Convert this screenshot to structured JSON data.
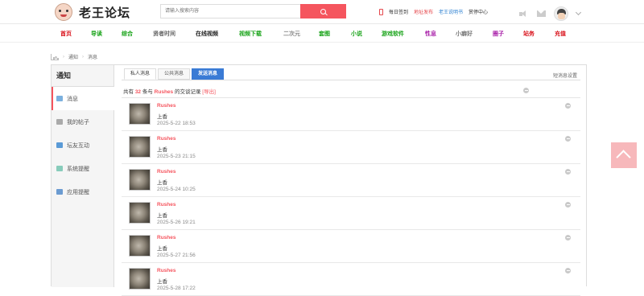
{
  "site": {
    "title": "老王论坛"
  },
  "search": {
    "placeholder": "请输入搜索内容"
  },
  "toplinks": {
    "signin": "每日签到",
    "address": "地址发布",
    "guide": "老王说明书",
    "bounty": "赏停中心"
  },
  "nav": [
    {
      "label": "首页",
      "color": "#d9121b"
    },
    {
      "label": "导读",
      "color": "#18a318"
    },
    {
      "label": "综合",
      "color": "#18a318"
    },
    {
      "label": "贤者时间",
      "color": "#666666"
    },
    {
      "label": "在线视频",
      "color": "#222222"
    },
    {
      "label": "视频下载",
      "color": "#18a318"
    },
    {
      "label": "二次元",
      "color": "#888888"
    },
    {
      "label": "套图",
      "color": "#18a318"
    },
    {
      "label": "小说",
      "color": "#18a318"
    },
    {
      "label": "游戏软件",
      "color": "#18a318"
    },
    {
      "label": "性息",
      "color": "#a81ea8"
    },
    {
      "label": "小癖好",
      "color": "#777777"
    },
    {
      "label": "圈子",
      "color": "#a81ea8"
    },
    {
      "label": "站务",
      "color": "#d9121b"
    },
    {
      "label": "充值",
      "color": "#d9121b"
    }
  ],
  "breadcrumb": {
    "level1": "通知",
    "level2": "消息"
  },
  "sidebar": {
    "title": "通知",
    "items": [
      {
        "label": "消息",
        "icon": "envelope-icon",
        "color": "#7bb0de",
        "active": true
      },
      {
        "label": "我的帖子",
        "icon": "document-icon",
        "color": "#aaa"
      },
      {
        "label": "坛友互动",
        "icon": "chat-icon",
        "color": "#5a9ad6"
      },
      {
        "label": "系统提醒",
        "icon": "diamond-icon",
        "color": "#8cb"
      },
      {
        "label": "应用提醒",
        "icon": "grid-icon",
        "color": "#6b9bd1"
      }
    ]
  },
  "tabs": {
    "private": "私人消息",
    "public": "公共消息",
    "send": "发送消息"
  },
  "settings_link": "短消息设置",
  "summary": {
    "prefix": "共有",
    "count": "32",
    "mid": "条与",
    "user": "Rushes",
    "suffix": "的交谈记录",
    "export": "[导出]"
  },
  "messages": [
    {
      "name": "Rushes",
      "text": "上香",
      "time": "2025-5-22 18:53"
    },
    {
      "name": "Rushes",
      "text": "上香",
      "time": "2025-5-23 21:15"
    },
    {
      "name": "Rushes",
      "text": "上香",
      "time": "2025-5-24 10:25"
    },
    {
      "name": "Rushes",
      "text": "上香",
      "time": "2025-5-26 19:21"
    },
    {
      "name": "Rushes",
      "text": "上香",
      "time": "2025-5-27 21:56"
    },
    {
      "name": "Rushes",
      "text": "上香",
      "time": "2025-5-28 17:22"
    }
  ]
}
